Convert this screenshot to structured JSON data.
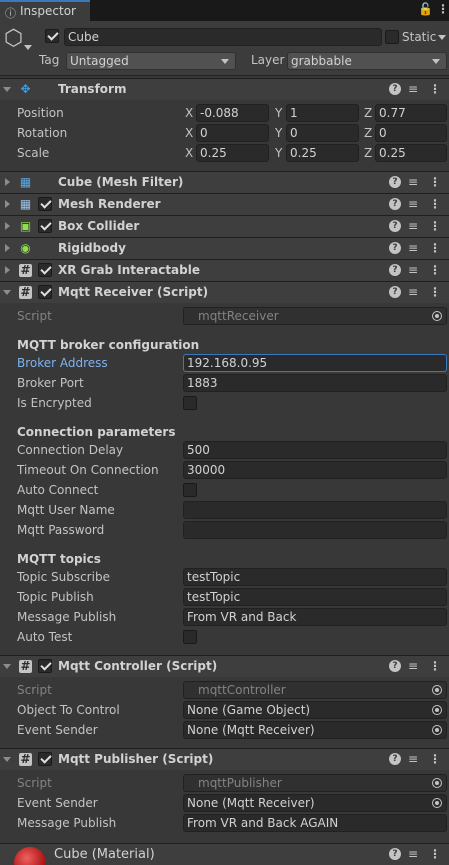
{
  "tab": {
    "icon": "info-icon",
    "label": "Inspector"
  },
  "object": {
    "name": "Cube",
    "static_label": "Static",
    "tag_label": "Tag",
    "tag_value": "Untagged",
    "layer_label": "Layer",
    "layer_value": "grabbable"
  },
  "transform": {
    "title": "Transform",
    "position_label": "Position",
    "rotation_label": "Rotation",
    "scale_label": "Scale",
    "position": {
      "x": "-0.088",
      "y": "1",
      "z": "0.77"
    },
    "rotation": {
      "x": "0",
      "y": "0",
      "z": "0"
    },
    "scale": {
      "x": "0.25",
      "y": "0.25",
      "z": "0.25"
    },
    "axis_x": "X",
    "axis_y": "Y",
    "axis_z": "Z"
  },
  "components": {
    "mesh_filter": "Cube (Mesh Filter)",
    "mesh_renderer": "Mesh Renderer",
    "box_collider": "Box Collider",
    "rigidbody": "Rigidbody",
    "xr_grab": "XR Grab Interactable",
    "mqtt_receiver": "Mqtt Receiver (Script)",
    "mqtt_controller": "Mqtt Controller (Script)",
    "mqtt_publisher": "Mqtt Publisher (Script)"
  },
  "receiver": {
    "script_label": "Script",
    "script_value": "mqttReceiver",
    "broker_header": "MQTT broker configuration",
    "broker_address_label": "Broker Address",
    "broker_address_value": "192.168.0.95",
    "broker_port_label": "Broker Port",
    "broker_port_value": "1883",
    "is_encrypted_label": "Is Encrypted",
    "conn_header": "Connection parameters",
    "conn_delay_label": "Connection Delay",
    "conn_delay_value": "500",
    "timeout_label": "Timeout On Connection",
    "timeout_value": "30000",
    "auto_connect_label": "Auto Connect",
    "user_label": "Mqtt User Name",
    "user_value": "",
    "password_label": "Mqtt Password",
    "password_value": "",
    "topics_header": "MQTT topics",
    "topic_sub_label": "Topic Subscribe",
    "topic_sub_value": "testTopic",
    "topic_pub_label": "Topic Publish",
    "topic_pub_value": "testTopic",
    "msg_pub_label": "Message Publish",
    "msg_pub_value": "From VR and Back",
    "auto_test_label": "Auto Test"
  },
  "controller": {
    "script_label": "Script",
    "script_value": "mqttController",
    "object_label": "Object To Control",
    "object_value": "None (Game Object)",
    "sender_label": "Event Sender",
    "sender_value": "None (Mqtt Receiver)"
  },
  "publisher": {
    "script_label": "Script",
    "script_value": "mqttPublisher",
    "sender_label": "Event Sender",
    "sender_value": "None (Mqtt Receiver)",
    "msg_label": "Message Publish",
    "msg_value": "From VR and Back AGAIN"
  },
  "material": {
    "label": "Cube (Material)"
  },
  "colors": {
    "background": "#383838",
    "accent": "#3a79bb",
    "header": "#3e3e3e"
  }
}
